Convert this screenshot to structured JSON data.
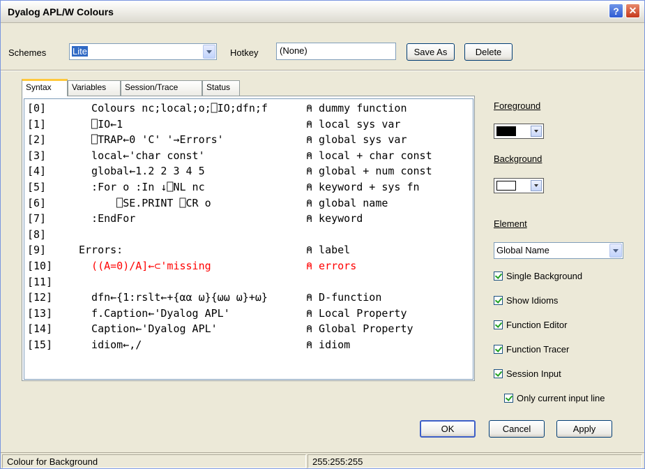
{
  "window": {
    "title": "Dyalog APL/W Colours",
    "help_label": "?",
    "close_label": "✕"
  },
  "top": {
    "schemes_label": "Schemes",
    "schemes_value": "Lite",
    "hotkey_label": "Hotkey",
    "hotkey_value": "(None)",
    "save_as_label": "Save As",
    "delete_label": "Delete"
  },
  "tabs": [
    "Syntax",
    "Variables",
    "Session/Trace",
    "Status"
  ],
  "code_lines": [
    {
      "num": "[0]",
      "text": "  Colours nc;local;o;⎕IO;dfn;f",
      "comment": "⍝ dummy function"
    },
    {
      "num": "[1]",
      "text": "  ⎕IO←1",
      "comment": "⍝ local sys var"
    },
    {
      "num": "[2]",
      "text": "  ⎕TRAP←0 'C' '→Errors'",
      "comment": "⍝ global sys var"
    },
    {
      "num": "[3]",
      "text": "  local←'char const'",
      "comment": "⍝ local + char const"
    },
    {
      "num": "[4]",
      "text": "  global←1.2 2 3 4 5",
      "comment": "⍝ global + num const"
    },
    {
      "num": "[5]",
      "text": "  :For o :In ↓⎕NL nc",
      "comment": "⍝ keyword + sys fn"
    },
    {
      "num": "[6]",
      "text": "      ⎕SE.PRINT ⎕CR o",
      "comment": "⍝ global name"
    },
    {
      "num": "[7]",
      "text": "  :EndFor",
      "comment": "⍝ keyword"
    },
    {
      "num": "[8]",
      "text": "",
      "comment": ""
    },
    {
      "num": "[9]",
      "text": "Errors:",
      "comment": "⍝ label"
    },
    {
      "num": "[10]",
      "text": "  ((A=0)/A]←⊂'missing",
      "comment": "⍝ errors",
      "error": true
    },
    {
      "num": "[11]",
      "text": "",
      "comment": ""
    },
    {
      "num": "[12]",
      "text": "  dfn←{1:rslt←+{⍺⍺ ⍵}{⍵⍵ ⍵}+⍵}",
      "comment": "⍝ D-function"
    },
    {
      "num": "[13]",
      "text": "  f.Caption←'Dyalog APL'",
      "comment": "⍝ Local Property"
    },
    {
      "num": "[14]",
      "text": "  Caption←'Dyalog APL'",
      "comment": "⍝ Global Property"
    },
    {
      "num": "[15]",
      "text": "  idiom←,/",
      "comment": "⍝ idiom"
    }
  ],
  "right": {
    "foreground_label": "Foreground",
    "foreground_color": "#000000",
    "background_label": "Background",
    "background_color": "#ffffff",
    "element_label": "Element",
    "element_value": "Global Name",
    "checks": [
      "Single Background",
      "Show Idioms",
      "Function Editor",
      "Function Tracer",
      "Session Input",
      "Only current input line"
    ]
  },
  "buttons": {
    "ok": "OK",
    "cancel": "Cancel",
    "apply": "Apply"
  },
  "status": {
    "left": "Colour for Background",
    "right": "255:255:255"
  },
  "colors": {
    "error": "#ff0000",
    "dfn_brace": "#0000ff",
    "tab_highlight": "#ffc83c"
  }
}
